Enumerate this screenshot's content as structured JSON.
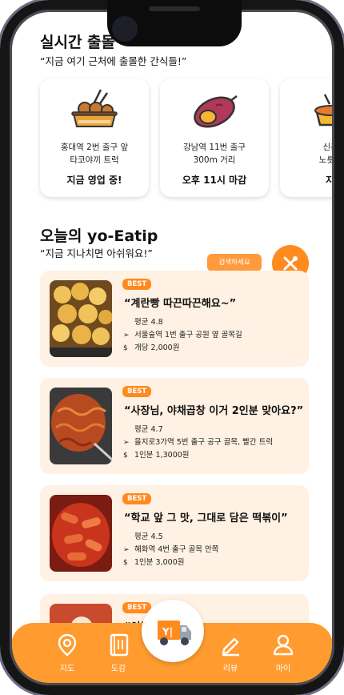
{
  "live": {
    "title": "실시간 출몰",
    "subtitle": "“지금 여기 근처에 출몰한 간식들!”",
    "cards": [
      {
        "desc": "홍대역 2번 출구 앞\n타코야끼 트럭",
        "status": "지금 영업 중!",
        "icon": "takoyaki-icon"
      },
      {
        "desc": "강남역 11번 출구\n300m 거리",
        "status": "오후 11시 마감",
        "icon": "sweet-potato-icon"
      },
      {
        "desc": "신촌역\n노릇노릇",
        "status": "지금",
        "icon": "food-icon"
      }
    ]
  },
  "eatip": {
    "title": "오늘의 yo-Eatip",
    "subtitle": "“지금 지나치면 아쉬워요!”",
    "search_label": "검색하세요",
    "cards": [
      {
        "badge": "BEST",
        "title": "“계란빵 따끈따끈해요~”",
        "rating": "평균 4.8",
        "location": "서울숲역 1번 출구 공원 옆 골목길",
        "price": "개당 2,000원",
        "photo": "egg-bread-photo"
      },
      {
        "badge": "BEST",
        "title": "“사장님, 야채곱창 이거 2인분 맞아요?”",
        "rating": "평균 4.7",
        "location": "을지로3가역 5번 출구 공구 골목, 빨간 트럭",
        "price": "1인분 1,3000원",
        "photo": "gopchang-photo"
      },
      {
        "badge": "BEST",
        "title": "“학교 앞 그 맛, 그대로 담은 떡볶이”",
        "rating": "평균 4.5",
        "location": "혜화역 4번 출구 골목 안쪽",
        "price": "1인분 3,000원",
        "photo": "tteokbokki-photo"
      },
      {
        "badge": "BEST",
        "title": "“이부",
        "photo": "fourth-photo"
      }
    ]
  },
  "nav": {
    "items": [
      {
        "label": "지도",
        "icon": "map-pin-icon"
      },
      {
        "label": "도감",
        "icon": "book-icon"
      },
      {
        "label": "리뷰",
        "icon": "pen-icon"
      },
      {
        "label": "마이",
        "icon": "user-icon"
      }
    ],
    "center_icon": "food-truck-icon"
  },
  "colors": {
    "accent": "#ff8a1e",
    "card_bg": "#fff1e3"
  }
}
